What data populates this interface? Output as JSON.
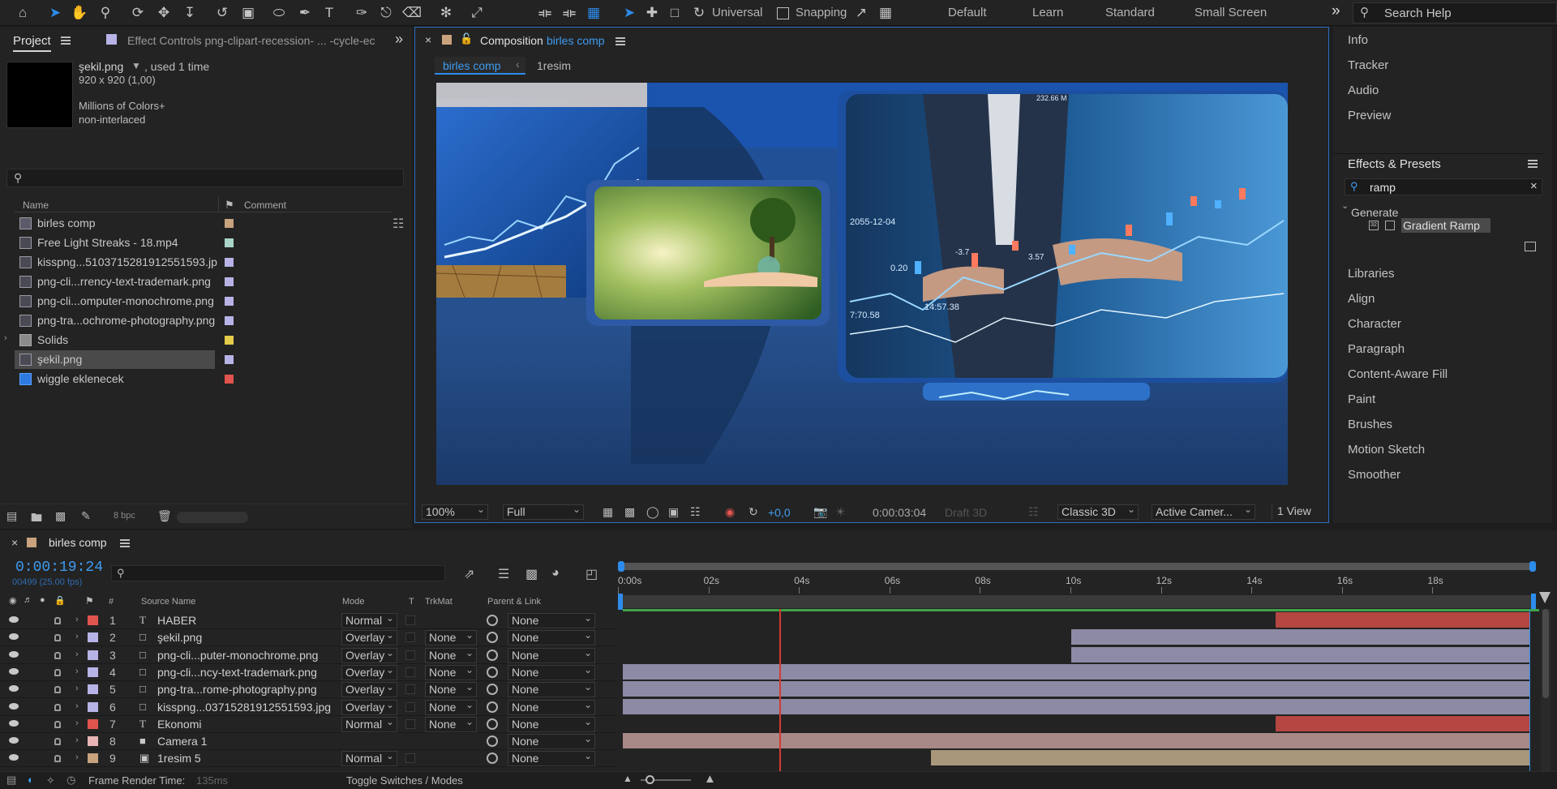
{
  "toolbar": {
    "tools": [
      "home-icon",
      "selection-icon",
      "hand-icon",
      "zoom-icon",
      "orbit-icon",
      "pan-icon",
      "dolly-icon",
      "rotate-icon",
      "anchor-icon",
      "ellipse-icon",
      "pen-icon",
      "type-icon",
      "brush-icon",
      "clone-stamp-icon",
      "eraser-icon",
      "roto-brush-icon",
      "puppet-pin-icon"
    ],
    "axis_mode": "Universal",
    "snapping_label": "Snapping",
    "workspaces": [
      "Default",
      "Learn",
      "Standard",
      "Small Screen"
    ],
    "search_help": "Search Help",
    "more_glyph": "»"
  },
  "project_panel": {
    "tab_label": "Project",
    "effect_controls_tab": "Effect Controls png-clipart-recession- ... -cycle-ec",
    "file_name": "şekil.png",
    "used_text": ", used 1 time",
    "dimensions": "920 x 920 (1,00)",
    "colors": "Millions of Colors+",
    "interlace": "non-interlaced",
    "search_placeholder": "",
    "col_name": "Name",
    "col_comment": "Comment",
    "items": [
      {
        "name": "birles comp",
        "type": "comp",
        "label_color": "#c9a27e"
      },
      {
        "name": "Free Light Streaks - 18.mp4",
        "type": "video",
        "label_color": "#a8d5c8"
      },
      {
        "name": "kisspng...5103715281912551593.jp",
        "type": "image",
        "label_color": "#b7b3e6"
      },
      {
        "name": "png-cli...rrency-text-trademark.png",
        "type": "image",
        "label_color": "#b7b3e6"
      },
      {
        "name": "png-cli...omputer-monochrome.png",
        "type": "image",
        "label_color": "#b7b3e6"
      },
      {
        "name": "png-tra...ochrome-photography.png",
        "type": "image",
        "label_color": "#b7b3e6"
      },
      {
        "name": "Solids",
        "type": "folder",
        "label_color": "#e5cc4b"
      },
      {
        "name": "şekil.png",
        "type": "image",
        "label_color": "#b7b3e6"
      },
      {
        "name": "wiggle eklenecek",
        "type": "solid",
        "label_color": "#e0544e"
      }
    ],
    "bpc": "8 bpc"
  },
  "comp_panel": {
    "tab_prefix": "Composition",
    "tab_name": "birles comp",
    "breadcrumbs": [
      "birles comp",
      "1resim"
    ],
    "zoom": "100%",
    "resolution": "Full",
    "exposure": "+0,0",
    "timecode": "0:00:03:04",
    "draft3d": "Draft 3D",
    "renderer": "Classic 3D",
    "camera": "Active Camer...",
    "views": "1 View",
    "viewer_text": [
      {
        "text": "2055-12-04"
      },
      {
        "text": "0.20"
      },
      {
        "text": "3.57"
      },
      {
        "text": "7:70.58"
      },
      {
        "text": "14:57.38"
      },
      {
        "text": "232.66 M"
      },
      {
        "text": "-3.7"
      }
    ]
  },
  "right_panel": {
    "items": [
      "Info",
      "Tracker",
      "Audio",
      "Preview"
    ],
    "effects_title": "Effects & Presets",
    "effects_search": "ramp",
    "generate": "Generate",
    "result": "Gradient Ramp",
    "items2": [
      "Libraries",
      "Align",
      "Character",
      "Paragraph",
      "Content-Aware Fill",
      "Paint",
      "Brushes",
      "Motion Sketch",
      "Smoother"
    ]
  },
  "timeline": {
    "tab_label": "birles comp",
    "timecode": "0:00:19:24",
    "frame_info": "00499 (25.00 fps)",
    "col_source": "Source Name",
    "col_mode": "Mode",
    "col_t": "T",
    "col_trkmat": "TrkMat",
    "col_parent": "Parent & Link",
    "col_num": "#",
    "ruler": [
      "0:00s",
      "02s",
      "04s",
      "06s",
      "08s",
      "10s",
      "12s",
      "14s",
      "16s",
      "18s"
    ],
    "layers": [
      {
        "num": "1",
        "name": "HABER",
        "type": "T",
        "label_color": "#e0544e",
        "mode": "Normal",
        "trkmat": "",
        "parent": "None",
        "bar_start": 0.72,
        "bar_end": 1.0,
        "bar_color": "#b54642"
      },
      {
        "num": "2",
        "name": "şekil.png",
        "type": "img",
        "label_color": "#b7b3e6",
        "mode": "Overlay",
        "trkmat": "None",
        "parent": "None",
        "bar_start": 0.495,
        "bar_end": 1.0,
        "bar_color": "#8d8aa6"
      },
      {
        "num": "3",
        "name": "png-cli...puter-monochrome.png",
        "type": "img",
        "label_color": "#b7b3e6",
        "mode": "Overlay",
        "trkmat": "None",
        "parent": "None",
        "bar_start": 0.495,
        "bar_end": 1.0,
        "bar_color": "#8d8aa6"
      },
      {
        "num": "4",
        "name": "png-cli...ncy-text-trademark.png",
        "type": "img",
        "label_color": "#b7b3e6",
        "mode": "Overlay",
        "trkmat": "None",
        "parent": "None",
        "bar_start": 0.0,
        "bar_end": 1.0,
        "bar_color": "#8d8aa6"
      },
      {
        "num": "5",
        "name": "png-tra...rome-photography.png",
        "type": "img",
        "label_color": "#b7b3e6",
        "mode": "Overlay",
        "trkmat": "None",
        "parent": "None",
        "bar_start": 0.0,
        "bar_end": 1.0,
        "bar_color": "#8d8aa6"
      },
      {
        "num": "6",
        "name": "kisspng...03715281912551593.jpg",
        "type": "img",
        "label_color": "#b7b3e6",
        "mode": "Overlay",
        "trkmat": "None",
        "parent": "None",
        "bar_start": 0.0,
        "bar_end": 1.0,
        "bar_color": "#8d8aa6"
      },
      {
        "num": "7",
        "name": "Ekonomi",
        "type": "T",
        "label_color": "#e0544e",
        "mode": "Normal",
        "trkmat": "None",
        "parent": "None",
        "bar_start": 0.72,
        "bar_end": 1.0,
        "bar_color": "#b54642"
      },
      {
        "num": "8",
        "name": "Camera 1",
        "type": "cam",
        "label_color": "#e8b5b5",
        "mode": "",
        "trkmat": "",
        "parent": "None",
        "bar_start": 0.0,
        "bar_end": 1.0,
        "bar_color": "#a98888"
      },
      {
        "num": "9",
        "name": "1resim 5",
        "type": "comp",
        "label_color": "#c9a27e",
        "mode": "Normal",
        "trkmat": "",
        "parent": "None",
        "bar_start": 0.34,
        "bar_end": 1.0,
        "bar_color": "#a8977a"
      }
    ],
    "playhead": 0.17,
    "render_label": "Frame Render Time:",
    "render_value": "135ms",
    "toggle_label": "Toggle Switches / Modes"
  },
  "colors": {
    "accent": "#2d8ceb",
    "panel_bg": "#232323",
    "timecode": "#3f9cf0"
  }
}
